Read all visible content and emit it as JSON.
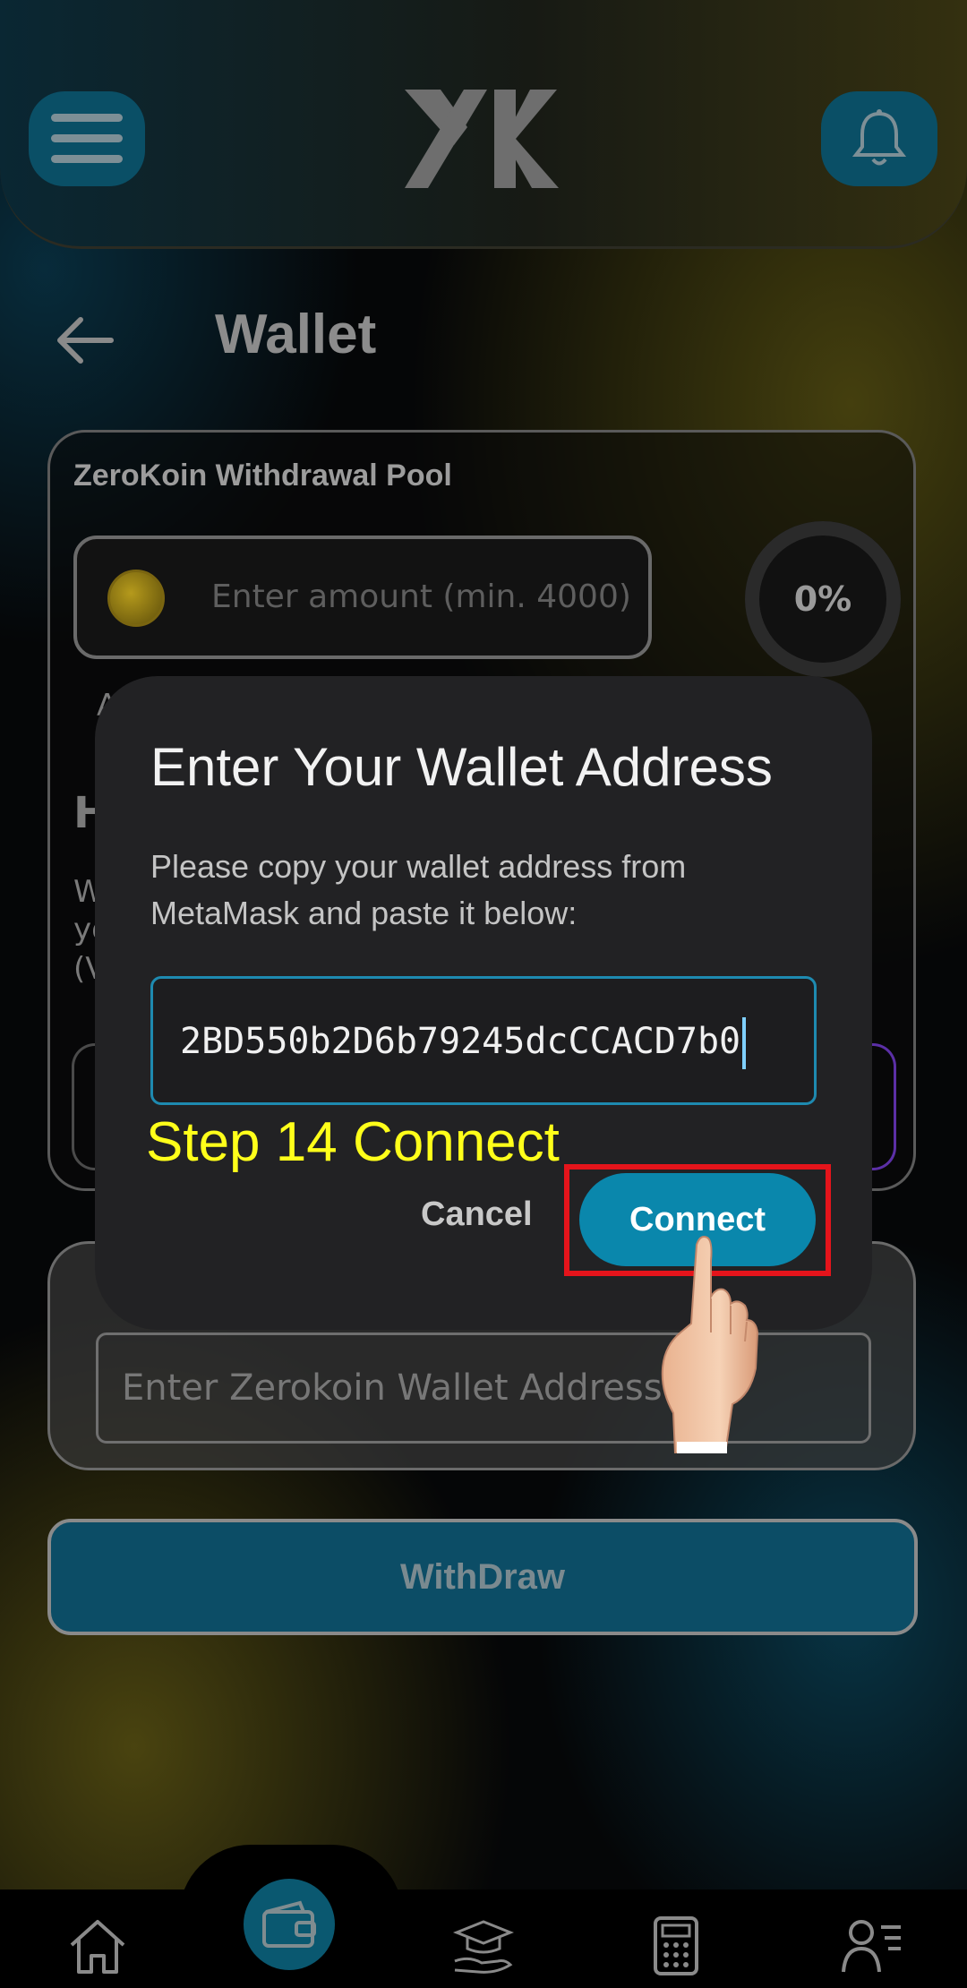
{
  "header": {
    "menu_icon": "hamburger-menu-icon",
    "logo_icon": "zx-logo-icon",
    "bell_icon": "bell-icon"
  },
  "page": {
    "back_icon": "arrow-left-icon",
    "title": "Wallet"
  },
  "pool_card": {
    "title": "ZeroKoin Withdrawal Pool",
    "amount_placeholder": "Enter amount (min. 4000)",
    "coin_icon": "zerokoin-coin-icon",
    "progress_label": "0%",
    "progress_value": 0
  },
  "background_fragments": [
    "A",
    "H",
    "W",
    "yo",
    "(V"
  ],
  "wallet_card": {
    "address_placeholder": "Enter Zerokoin Wallet Address"
  },
  "withdraw_label": "WithDraw",
  "dialog": {
    "title": "Enter Your Wallet Address",
    "message": "Please copy your wallet address from MetaMask and paste it below:",
    "address_value": "2BD550b2D6b79245dcCCACD7b0",
    "cancel_label": "Cancel",
    "connect_label": "Connect"
  },
  "annotation": {
    "step_label": "Step 14 Connect",
    "highlight_color": "#e5141b",
    "step_color": "#ffff1a"
  },
  "bottom_nav": {
    "items": [
      {
        "icon": "home-icon"
      },
      {
        "icon": "wallet-icon",
        "active": true
      },
      {
        "icon": "graduation-cap-icon"
      },
      {
        "icon": "calculator-icon"
      },
      {
        "icon": "profile-list-icon"
      }
    ]
  },
  "colors": {
    "accent": "#0a87ac",
    "header_button": "#0a4f66"
  }
}
